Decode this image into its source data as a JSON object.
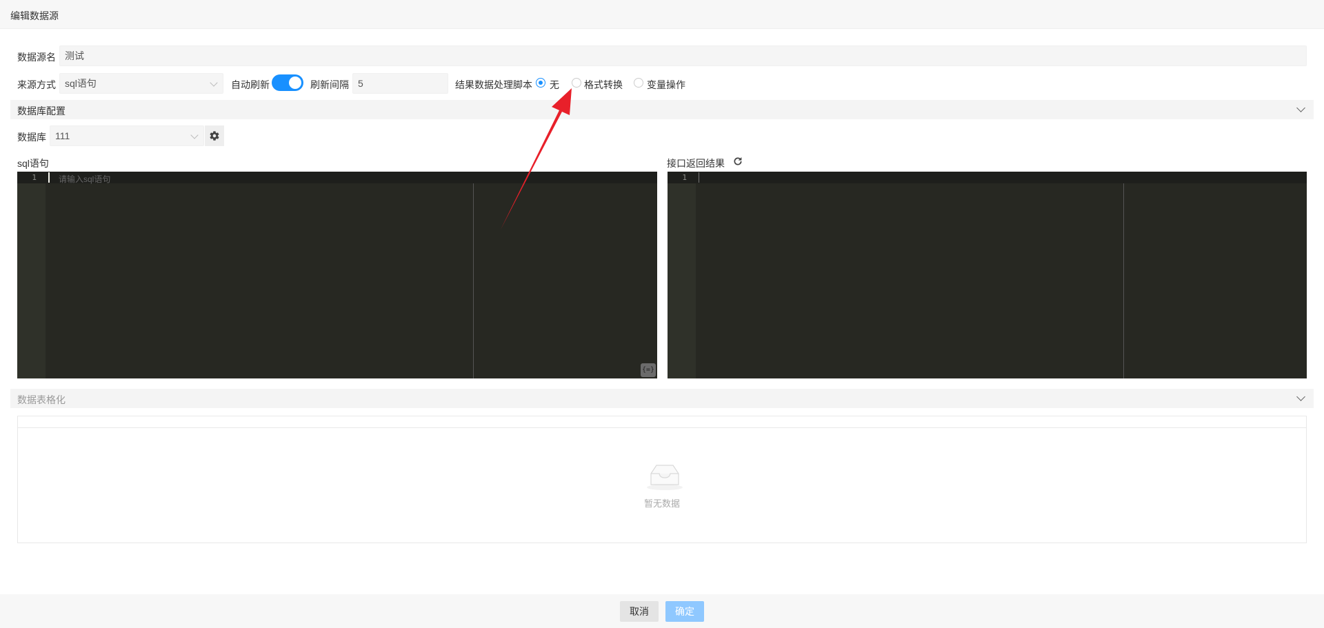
{
  "dialog": {
    "title": "编辑数据源"
  },
  "form": {
    "name_label": "数据源名",
    "name_value": "测试",
    "source_label": "来源方式",
    "source_value": "sql语句",
    "auto_refresh_label": "自动刷新",
    "auto_refresh_on": true,
    "interval_label": "刷新间隔",
    "interval_value": "5",
    "script_label": "结果数据处理脚本",
    "script_options": [
      "无",
      "格式转换",
      "变量操作"
    ],
    "script_selected": "无"
  },
  "db_section": {
    "title": "数据库配置",
    "db_label": "数据库",
    "db_value": "111"
  },
  "sql_editor": {
    "label": "sql语句",
    "line": "1",
    "placeholder": "请输入sql语句",
    "format_icon": "{=}"
  },
  "result_editor": {
    "label": "接口返回结果",
    "line": "1"
  },
  "table_section": {
    "title": "数据表格化",
    "empty_text": "暂无数据"
  },
  "footer": {
    "cancel": "取消",
    "ok": "确定"
  },
  "colors": {
    "accent": "#1890ff",
    "annotation_arrow": "#e8202a",
    "editor_bg": "#272822"
  }
}
